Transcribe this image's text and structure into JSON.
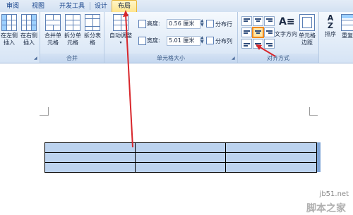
{
  "tabs": [
    "审阅",
    "视图",
    "开发工具",
    "设计",
    "布局"
  ],
  "groups": {
    "rows_cols": {
      "insert_left": "在左侧插入",
      "insert_right": "在右侧插入"
    },
    "merge": {
      "label": "合并",
      "merge_cells": "合并单元格",
      "split_cells": "拆分单元格",
      "split_table": "拆分表格"
    },
    "cell_size": {
      "label": "单元格大小",
      "autofit": "自动调整",
      "height_label": "高度:",
      "height_value": "0.56 厘米",
      "width_label": "宽度:",
      "width_value": "5.01 厘米",
      "distribute_rows": "分布行",
      "distribute_cols": "分布列"
    },
    "alignment": {
      "label": "对齐方式",
      "text_direction": "文字方向",
      "cell_margins": "单元格边距"
    },
    "data": {
      "sort": "排序",
      "repeat": "重复"
    }
  },
  "watermark": {
    "line1": "jb51.net",
    "line2": "脚本之家"
  },
  "colors": {
    "accent": "#ffe58e",
    "arrow": "#d8262b",
    "table_selection": "#bcd3ef"
  }
}
